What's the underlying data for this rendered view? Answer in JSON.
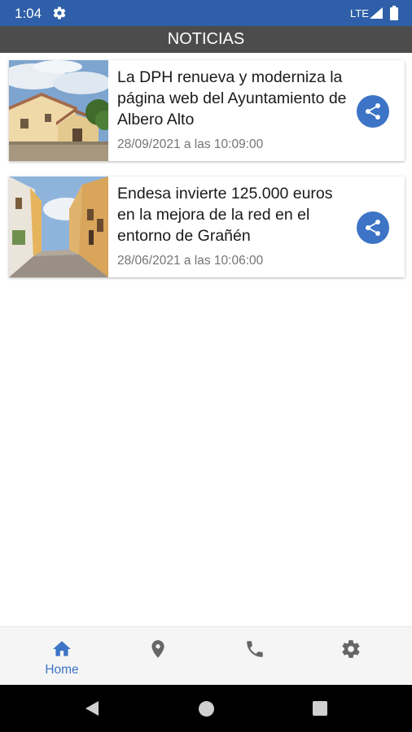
{
  "status_bar": {
    "time": "1:04",
    "network": "LTE",
    "icons": [
      "gear-icon",
      "signal-icon",
      "battery-icon"
    ]
  },
  "header": {
    "title": "NOTICIAS",
    "background": "#4c4c4c"
  },
  "news": [
    {
      "title": "La DPH renueva y moderniza la página web del Ayuntamiento de Albero Alto",
      "date": "28/09/2021 a las 10:09:00",
      "image": "town-hall-building",
      "action_icon": "share-icon"
    },
    {
      "title": "Endesa invierte 125.000 euros en la mejora de la red en el entorno de Grañén",
      "date": "28/06/2021 a las 10:06:00",
      "image": "village-street",
      "action_icon": "share-icon"
    }
  ],
  "bottom_nav": {
    "items": [
      {
        "icon": "home-icon",
        "label": "Home",
        "active": true
      },
      {
        "icon": "location-pin-icon",
        "label": "",
        "active": false
      },
      {
        "icon": "phone-icon",
        "label": "",
        "active": false
      },
      {
        "icon": "settings-icon",
        "label": "",
        "active": false
      }
    ]
  },
  "colors": {
    "status_bar": "#2f5fa8",
    "accent": "#3d74c6",
    "nav_inactive": "#666666"
  }
}
